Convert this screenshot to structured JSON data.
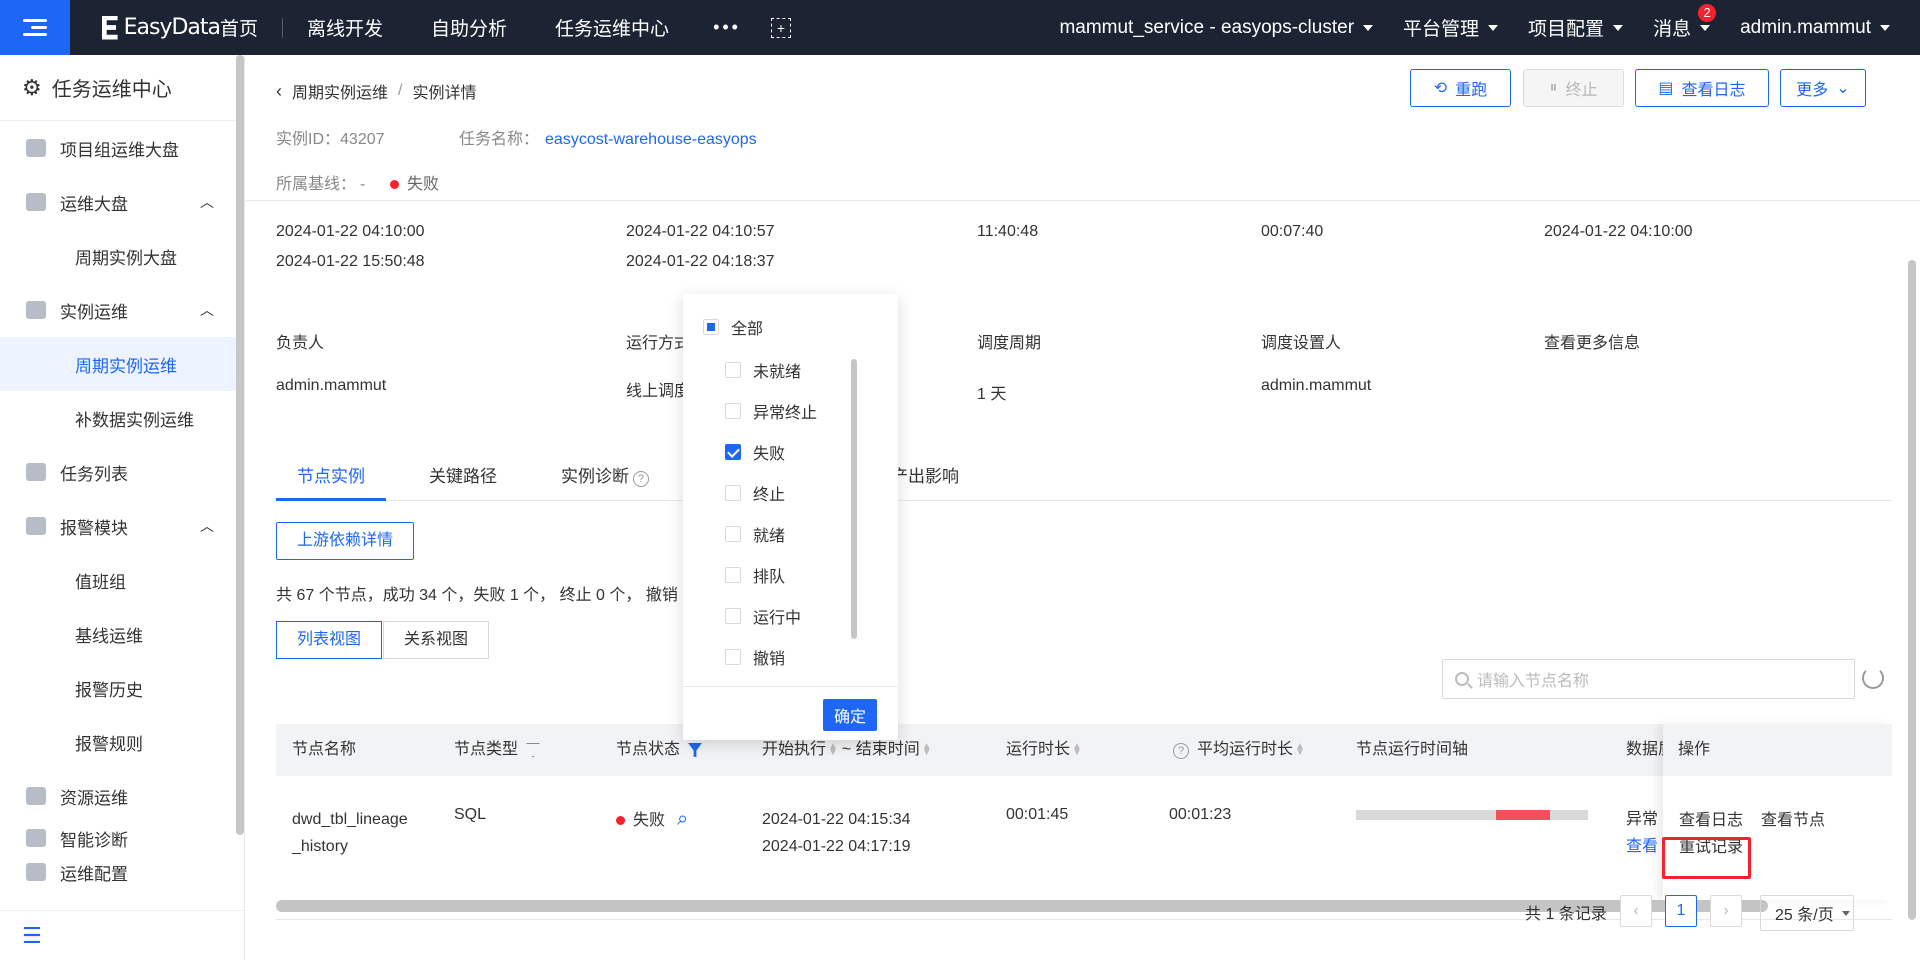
{
  "topbar": {
    "logo": "EasyData",
    "nav": [
      "首页",
      "离线开发",
      "自助分析",
      "任务运维中心"
    ],
    "more": "•••",
    "cluster": "mammut_service - easyops-cluster",
    "platform": "平台管理",
    "project_config": "项目配置",
    "messages": "消息",
    "message_count": "2",
    "user": "admin.mammut"
  },
  "sidebar": {
    "title": "任务运维中心",
    "items": [
      {
        "label": "项目组运维大盘",
        "type": "item"
      },
      {
        "label": "运维大盘",
        "type": "group"
      },
      {
        "label": "周期实例大盘",
        "type": "sub"
      },
      {
        "label": "实例运维",
        "type": "group"
      },
      {
        "label": "周期实例运维",
        "type": "sub"
      },
      {
        "label": "补数据实例运维",
        "type": "sub"
      },
      {
        "label": "任务列表",
        "type": "item"
      },
      {
        "label": "报警模块",
        "type": "group"
      },
      {
        "label": "值班组",
        "type": "sub"
      },
      {
        "label": "基线运维",
        "type": "sub"
      },
      {
        "label": "报警历史",
        "type": "sub"
      },
      {
        "label": "报警规则",
        "type": "sub"
      },
      {
        "label": "资源运维",
        "type": "item"
      },
      {
        "label": "智能诊断",
        "type": "item"
      },
      {
        "label": "运维配置",
        "type": "item"
      }
    ]
  },
  "breadcrumb": {
    "parent": "周期实例运维",
    "sep": "/",
    "current": "实例详情"
  },
  "actions": {
    "rerun": "重跑",
    "stop": "终止",
    "view_log": "查看日志",
    "more": "更多"
  },
  "instance": {
    "id_label": "实例ID：",
    "id": "43207",
    "task_label": "任务名称：",
    "task_name": "easycost-warehouse-easyops",
    "baseline_label": "所属基线：",
    "baseline": "-",
    "status": "失败"
  },
  "times": {
    "c1a": "2024-01-22 04:10:00",
    "c1b": "2024-01-22 15:50:48",
    "c2a": "2024-01-22 04:10:57",
    "c2b": "2024-01-22 04:18:37",
    "c3": "11:40:48",
    "c4": "00:07:40",
    "c5": "2024-01-22 04:10:00"
  },
  "details": {
    "owner_label": "负责人",
    "owner": "admin.mammut",
    "run_mode_label": "运行方式",
    "run_mode": "线上调度",
    "period_label": "调度周期",
    "period": "1 天",
    "setter_label": "调度设置人",
    "setter": "admin.mammut",
    "more_info": "查看更多信息"
  },
  "tabs": [
    "节点实例",
    "关键路径",
    "实例诊断",
    "产出影响"
  ],
  "upstream_btn": "上游依赖详情",
  "summary": "共 67 个节点，成功 34 个，失败 1 个， 终止 0 个， 撤销",
  "views": [
    "列表视图",
    "关系视图"
  ],
  "search": {
    "placeholder": "请输入节点名称"
  },
  "table": {
    "headers": {
      "name": "节点名称",
      "type": "节点类型",
      "status": "节点状态",
      "start": "开始执行",
      "end": "~ 结束时间",
      "duration": "运行时长",
      "avg": "平均运行时长",
      "timeline": "节点运行时间轴",
      "data": "数据质",
      "ops": "操作"
    },
    "row": {
      "name_line1": "dwd_tbl_lineage",
      "name_line2": "_history",
      "type": "SQL",
      "status": "失败",
      "start": "2024-01-22 04:15:34",
      "end": "2024-01-22 04:17:19",
      "duration": "00:01:45",
      "avg": "00:01:23",
      "data_quality": "异常",
      "data_link": "查看",
      "op_log": "查看日志",
      "op_node": "查看节点",
      "op_retry": "重试记录"
    }
  },
  "pagination": {
    "total": "共 1 条记录",
    "page": "1",
    "size": "25 条/页"
  },
  "status_filter": {
    "all": "全部",
    "options": [
      {
        "label": "未就绪",
        "checked": false
      },
      {
        "label": "异常终止",
        "checked": false
      },
      {
        "label": "失败",
        "checked": true
      },
      {
        "label": "终止",
        "checked": false
      },
      {
        "label": "就绪",
        "checked": false
      },
      {
        "label": "排队",
        "checked": false
      },
      {
        "label": "运行中",
        "checked": false
      },
      {
        "label": "撤销",
        "checked": false
      }
    ],
    "confirm": "确定"
  },
  "colors": {
    "primary": "#1e66f5",
    "danger": "#f5222d",
    "topbar": "#1c2433"
  }
}
